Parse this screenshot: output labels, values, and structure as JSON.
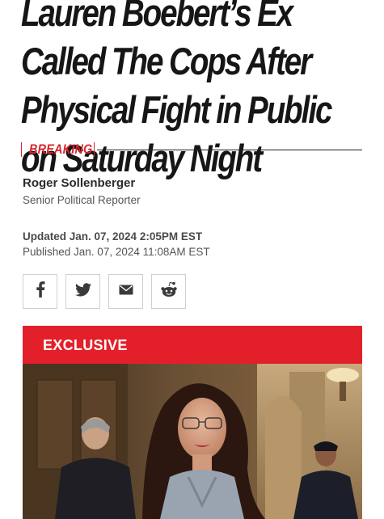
{
  "article": {
    "headline": "Lauren Boebert’s Ex Called The Cops After Physical Fight in Public on Saturday Night",
    "category": "BREAKING",
    "author_name": "Roger Sollenberger",
    "author_role": "Senior Political Reporter",
    "updated": "Updated Jan. 07, 2024 2:05PM EST",
    "published": "Published Jan. 07, 2024 11:08AM EST"
  },
  "share": {
    "buttons": [
      {
        "icon": "facebook-icon"
      },
      {
        "icon": "twitter-icon"
      },
      {
        "icon": "email-icon"
      },
      {
        "icon": "reddit-icon"
      }
    ]
  },
  "hero": {
    "badge": "EXCLUSIVE"
  },
  "colors": {
    "accent": "#e3202a",
    "breaking": "#d9262c",
    "text": "#161616"
  }
}
